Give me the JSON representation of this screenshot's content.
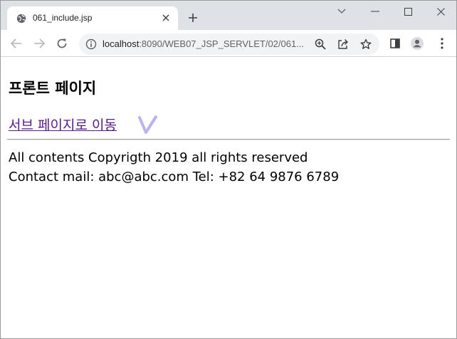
{
  "browser": {
    "tab": {
      "title": "061_include.jsp",
      "favicon": "globe-icon"
    },
    "address": {
      "host": "localhost",
      "rest": ":8090/WEB07_JSP_SERVLET/02/061..."
    },
    "icons": {
      "back": "arrow-left-icon",
      "forward": "arrow-right-icon",
      "reload": "reload-icon",
      "info": "info-icon",
      "zoom": "zoom-icon",
      "share": "share-icon",
      "bookmark": "star-icon",
      "side_panel": "side-panel-icon",
      "profile": "profile-icon",
      "menu": "kebab-menu-icon"
    }
  },
  "page": {
    "heading": "프론트 페이지",
    "sub_link": "서브 페이지로 이동",
    "footer": {
      "line1": "All contents Copyrigth 2019 all rights reserved",
      "line2": "Contact mail: abc@abc.com Tel: +82 64 9876 6789"
    }
  },
  "colors": {
    "link_visited": "#551a8b",
    "annotation_check": "#b9b3ee",
    "tabstrip": "#dee1e6",
    "omnibox": "#f1f3f4"
  }
}
